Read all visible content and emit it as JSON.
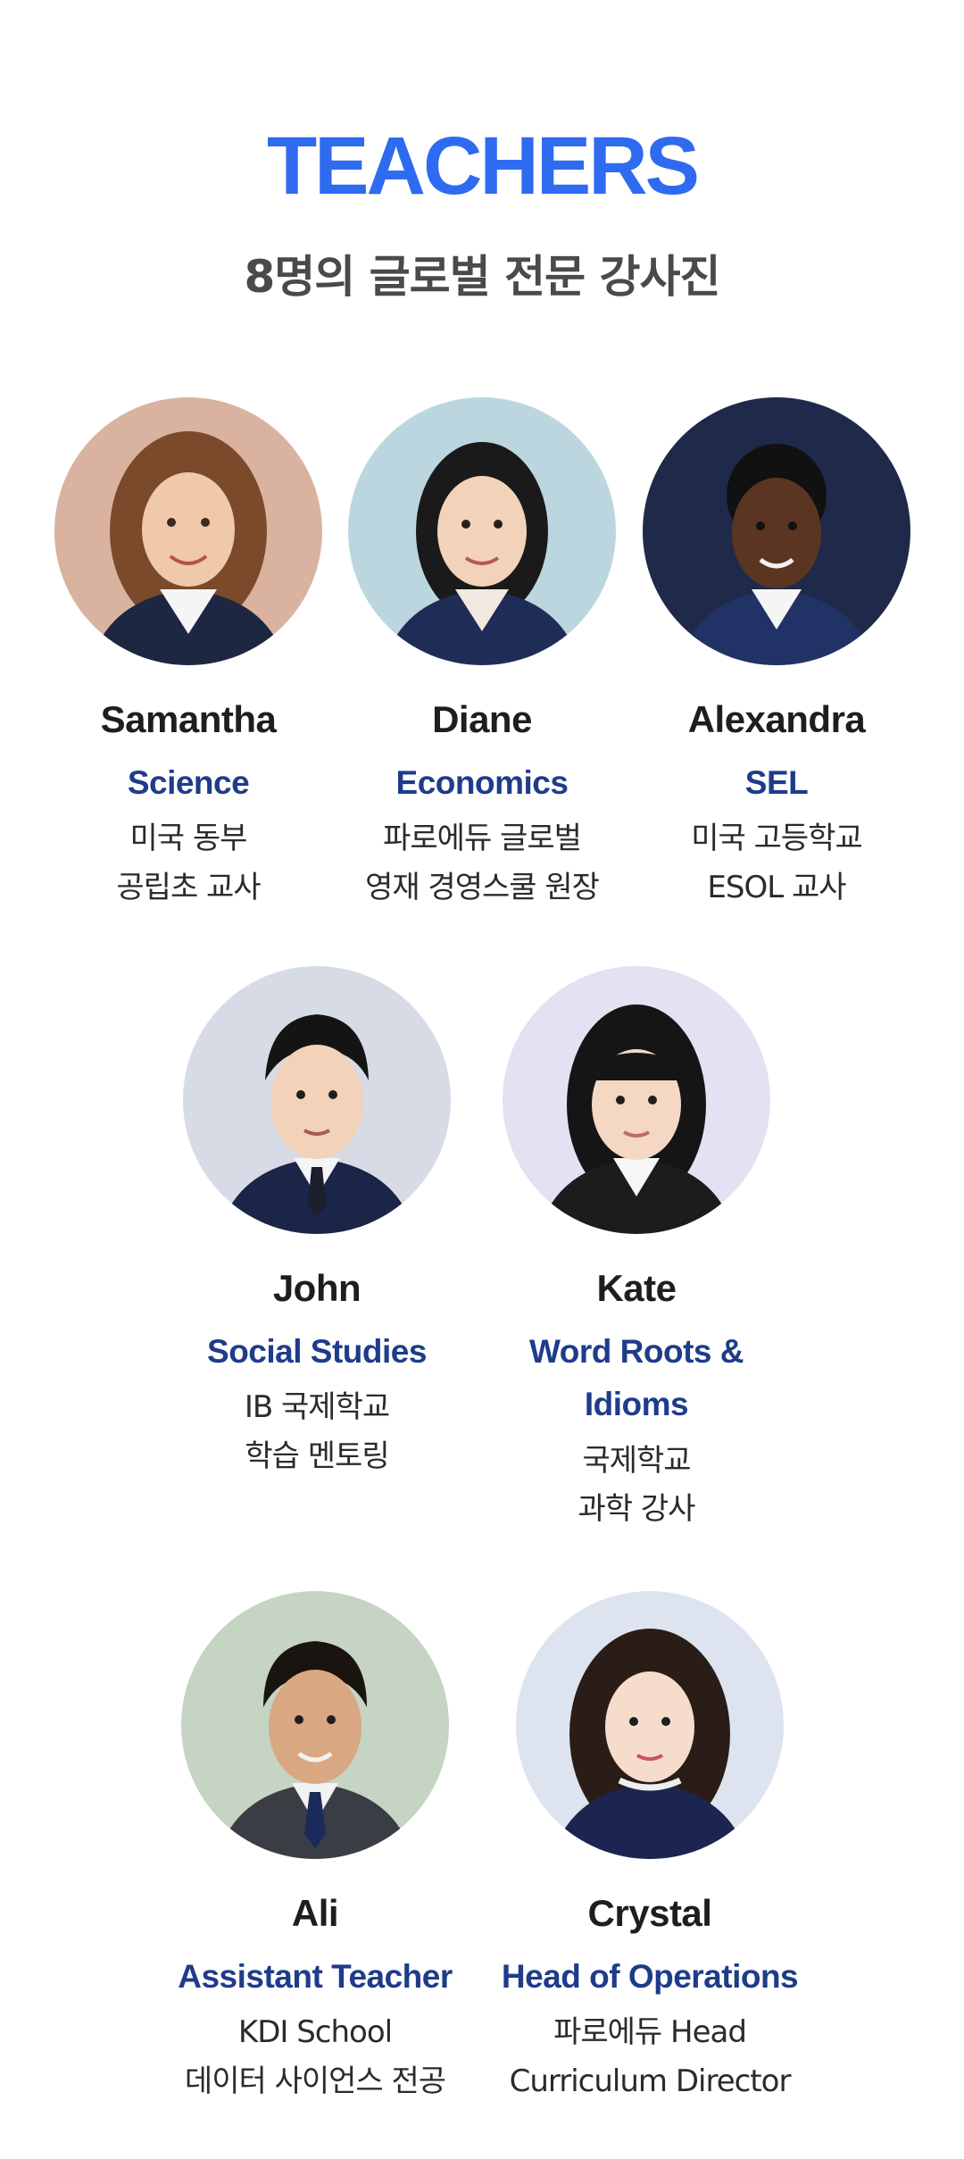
{
  "header": {
    "title": "TEACHERS",
    "subtitle": "8명의 글로벌 전문 강사진",
    "accent_color": "#2f6bf0"
  },
  "teachers": [
    {
      "name": "Samantha",
      "subject": "Science",
      "desc_line1": "미국 동부",
      "desc_line2": "공립초 교사",
      "photo_bg": "#d9b3a0"
    },
    {
      "name": "Diane",
      "subject": "Economics",
      "desc_line1": "파로에듀 글로벌",
      "desc_line2": "영재 경영스쿨 원장",
      "photo_bg": "#bcd6e0"
    },
    {
      "name": "Alexandra",
      "subject": "SEL",
      "desc_line1": "미국 고등학교",
      "desc_line2": "ESOL 교사",
      "photo_bg": "#1f2a4a"
    },
    {
      "name": "John",
      "subject": "Social Studies",
      "desc_line1": "IB 국제학교",
      "desc_line2": "학습 멘토링",
      "photo_bg": "#d6dbe6"
    },
    {
      "name": "Kate",
      "subject_line1": "Word Roots &",
      "subject_line2": "Idioms",
      "desc_line1": "국제학교",
      "desc_line2": "과학 강사",
      "photo_bg": "#e6e0f3"
    },
    {
      "name": "Ali",
      "subject": "Assistant Teacher",
      "desc_line1": "KDI School",
      "desc_line2": "데이터 사이언스 전공",
      "photo_bg": "#c5d4c3"
    },
    {
      "name": "Crystal",
      "subject": "Head of Operations",
      "desc_line1": "파로에듀 Head",
      "desc_line2": "Curriculum Director",
      "photo_bg": "#dde4ef"
    }
  ]
}
